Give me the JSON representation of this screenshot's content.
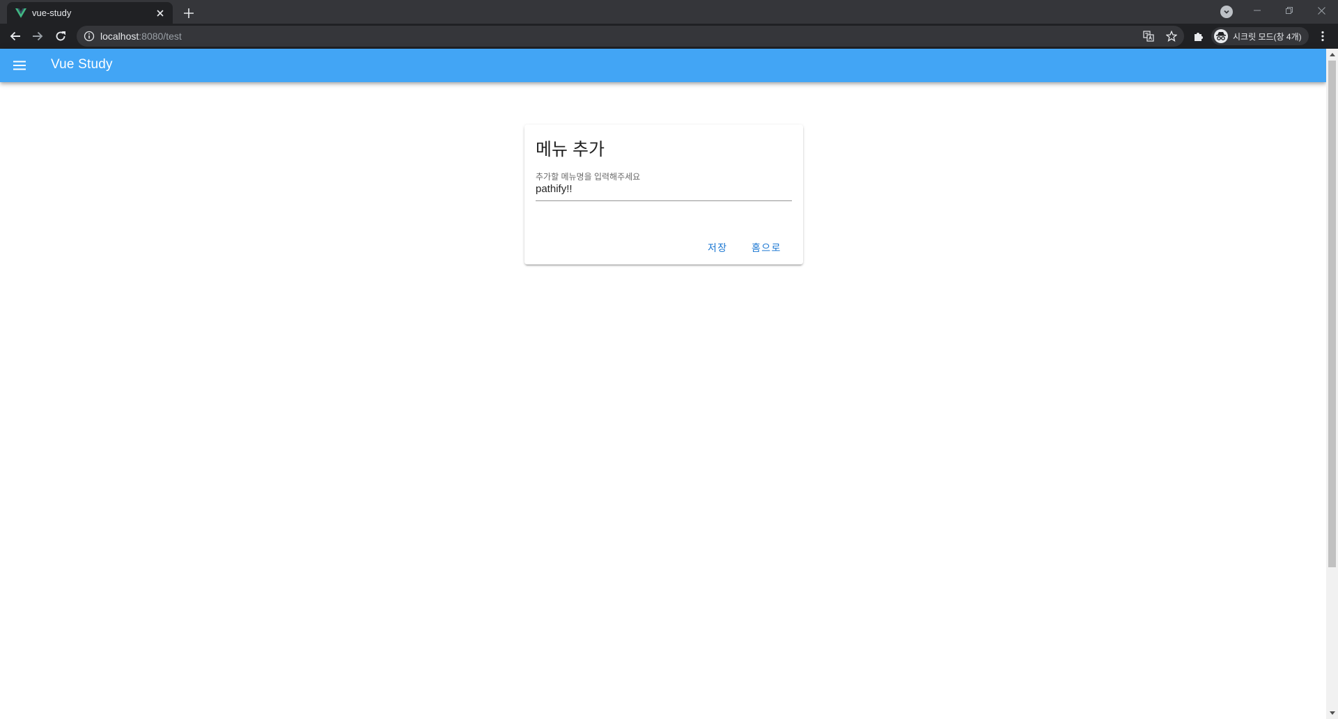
{
  "browser": {
    "tab_title": "vue-study",
    "url_host": "localhost",
    "url_rest": ":8080/test",
    "profile_label": "시크릿 모드(창 4개)",
    "favicon_color": "#41b883"
  },
  "app": {
    "title": "Vue Study",
    "bar_color": "#42a5f5"
  },
  "card": {
    "title": "메뉴 추가",
    "field_label": "추가할 메뉴명을 입력해주세요",
    "field_value": "pathify!!",
    "save_label": "저장",
    "home_label": "홈으로",
    "button_color": "#1976d2"
  },
  "icons": {
    "tab_close": "close-icon",
    "new_tab": "plus-icon",
    "back": "arrow-left-icon",
    "forward": "arrow-right-icon",
    "reload": "reload-icon",
    "site_info": "info-icon",
    "translate": "translate-icon",
    "bookmark": "star-icon",
    "extensions": "puzzle-icon",
    "incognito": "incognito-icon",
    "menu": "kebab-menu-icon",
    "nav_drawer": "hamburger-icon"
  }
}
